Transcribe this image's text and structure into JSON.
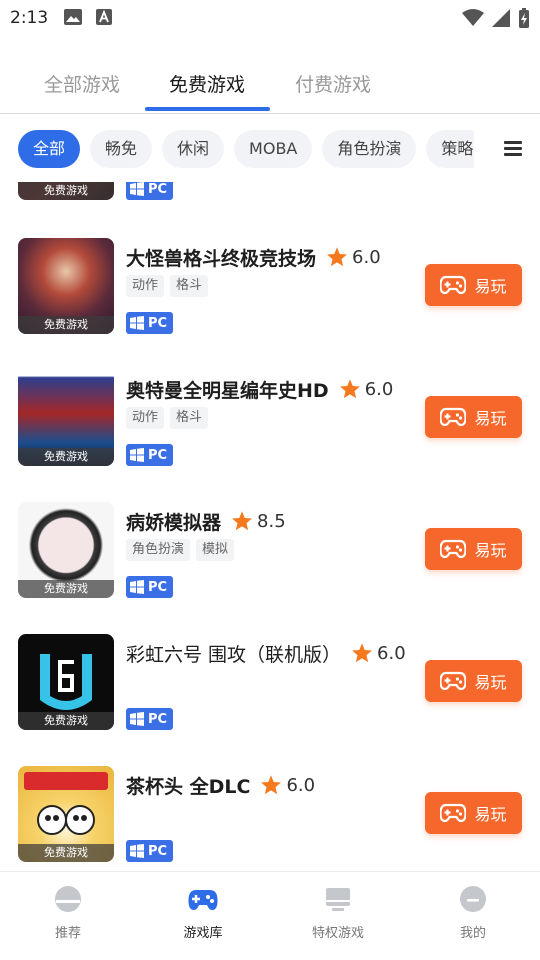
{
  "status": {
    "time": "2:13"
  },
  "tabs": [
    {
      "label": "全部游戏",
      "active": false
    },
    {
      "label": "免费游戏",
      "active": true
    },
    {
      "label": "付费游戏",
      "active": false
    }
  ],
  "filters": [
    "全部",
    "畅免",
    "休闲",
    "MOBA",
    "角色扮演",
    "策略"
  ],
  "accent_color": "#2f6de8",
  "play_button_color": "#f5672a",
  "games": [
    {
      "title": "",
      "rating": "",
      "tags": [],
      "badge": "免费游戏",
      "platform": "PC"
    },
    {
      "title": "大怪兽格斗终极竞技场",
      "rating": "6.0",
      "tags": [
        "动作",
        "格斗"
      ],
      "badge": "免费游戏",
      "platform": "PC",
      "button": "易玩"
    },
    {
      "title": "奥特曼全明星编年史HD",
      "rating": "6.0",
      "tags": [
        "动作",
        "格斗"
      ],
      "badge": "免费游戏",
      "platform": "PC",
      "button": "易玩"
    },
    {
      "title": "病娇模拟器",
      "rating": "8.5",
      "tags": [
        "角色扮演",
        "模拟"
      ],
      "badge": "免费游戏",
      "platform": "PC",
      "button": "易玩"
    },
    {
      "title": "彩虹六号 围攻（联机版）",
      "rating": "6.0",
      "tags": [],
      "badge": "免费游戏",
      "platform": "PC",
      "button": "易玩"
    },
    {
      "title": "茶杯头 全DLC",
      "rating": "6.0",
      "tags": [],
      "badge": "免费游戏",
      "platform": "PC",
      "button": "易玩"
    }
  ],
  "bottom_nav": [
    {
      "label": "推荐",
      "icon": "home-icon",
      "active": false
    },
    {
      "label": "游戏库",
      "icon": "gamepad-icon",
      "active": true
    },
    {
      "label": "特权游戏",
      "icon": "monitor-icon",
      "active": false
    },
    {
      "label": "我的",
      "icon": "profile-icon",
      "active": false
    }
  ]
}
